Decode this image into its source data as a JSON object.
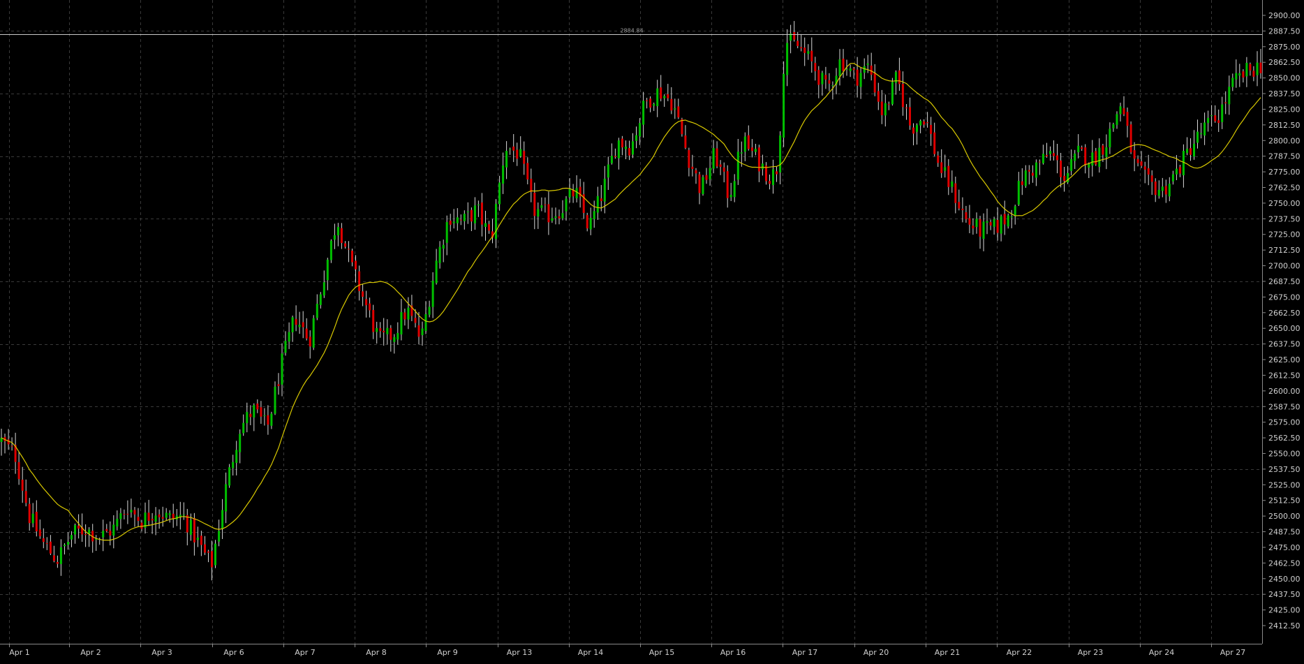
{
  "colors": {
    "background": "#000000",
    "grid": "#3a3a3a",
    "axis": "#8a8a8a",
    "text": "#d0d0d0",
    "bull": "#00c000",
    "bear": "#e00000",
    "ma": "#d8c800",
    "price_line": "#c8c8c8"
  },
  "chart_data": {
    "type": "candlestick",
    "title": "",
    "xlabel": "",
    "ylabel": "",
    "ylim": [
      2400,
      2900
    ],
    "grid": true,
    "price_line": {
      "value": 2884.84,
      "label": "2884.84"
    },
    "y_ticks": [
      2900.0,
      2887.5,
      2875.0,
      2862.5,
      2850.0,
      2837.5,
      2825.0,
      2812.5,
      2800.0,
      2787.5,
      2775.0,
      2762.5,
      2750.0,
      2737.5,
      2725.0,
      2712.5,
      2700.0,
      2687.5,
      2675.0,
      2662.5,
      2650.0,
      2637.5,
      2625.0,
      2612.5,
      2600.0,
      2587.5,
      2575.0,
      2562.5,
      2550.0,
      2537.5,
      2525.0,
      2512.5,
      2500.0,
      2487.5,
      2475.0,
      2462.5,
      2450.0,
      2437.5,
      2425.0,
      2412.5
    ],
    "y_tick_labels": [
      "2900.00",
      "2887.50",
      "2875.00",
      "2862.50",
      "2850.00",
      "2837.50",
      "2825.00",
      "2812.50",
      "2800.00",
      "2787.50",
      "2775.00",
      "2762.50",
      "2750.00",
      "2737.50",
      "2725.00",
      "2712.50",
      "2700.00",
      "2687.50",
      "2675.00",
      "2662.50",
      "2650.00",
      "2637.50",
      "2625.00",
      "2612.50",
      "2600.00",
      "2587.50",
      "2575.00",
      "2562.50",
      "2550.00",
      "2537.50",
      "2525.00",
      "2512.50",
      "2500.00",
      "2487.50",
      "2475.00",
      "2462.50",
      "2450.00",
      "2437.50",
      "2425.00",
      "2412.50"
    ],
    "x_labels": [
      "Apr 1",
      "Apr 2",
      "Apr 3",
      "Apr 6",
      "Apr 7",
      "Apr 8",
      "Apr 9",
      "Apr 13",
      "Apr 14",
      "Apr 15",
      "Apr 16",
      "Apr 17",
      "Apr 20",
      "Apr 21",
      "Apr 22",
      "Apr 23",
      "Apr 24",
      "Apr 27"
    ],
    "session_path": [
      [
        0,
        2560
      ],
      [
        2,
        2548
      ],
      [
        4,
        2500
      ],
      [
        6,
        2478
      ],
      [
        8,
        2465
      ],
      [
        10,
        2485
      ],
      [
        12,
        2490
      ],
      [
        14,
        2483
      ],
      [
        16,
        2490
      ],
      [
        18,
        2508
      ],
      [
        20,
        2496
      ],
      [
        22,
        2505
      ],
      [
        24,
        2498
      ],
      [
        26,
        2500
      ],
      [
        28,
        2480
      ],
      [
        30,
        2460
      ],
      [
        32,
        2520
      ],
      [
        34,
        2570
      ],
      [
        36,
        2585
      ],
      [
        38,
        2570
      ],
      [
        40,
        2620
      ],
      [
        42,
        2660
      ],
      [
        44,
        2640
      ],
      [
        46,
        2690
      ],
      [
        48,
        2738
      ],
      [
        50,
        2700
      ],
      [
        52,
        2670
      ],
      [
        54,
        2640
      ],
      [
        56,
        2645
      ],
      [
        58,
        2665
      ],
      [
        60,
        2640
      ],
      [
        62,
        2700
      ],
      [
        64,
        2740
      ],
      [
        66,
        2735
      ],
      [
        68,
        2745
      ],
      [
        70,
        2720
      ],
      [
        72,
        2795
      ],
      [
        74,
        2790
      ],
      [
        76,
        2745
      ],
      [
        78,
        2740
      ],
      [
        80,
        2745
      ],
      [
        82,
        2760
      ],
      [
        84,
        2730
      ],
      [
        86,
        2760
      ],
      [
        88,
        2800
      ],
      [
        90,
        2795
      ],
      [
        92,
        2830
      ],
      [
        94,
        2840
      ],
      [
        96,
        2830
      ],
      [
        98,
        2790
      ],
      [
        100,
        2760
      ],
      [
        102,
        2790
      ],
      [
        104,
        2755
      ],
      [
        106,
        2800
      ],
      [
        108,
        2785
      ],
      [
        110,
        2770
      ],
      [
        111,
        2780
      ],
      [
        112,
        2880
      ],
      [
        114,
        2875
      ],
      [
        116,
        2860
      ],
      [
        118,
        2840
      ],
      [
        120,
        2865
      ],
      [
        122,
        2850
      ],
      [
        124,
        2860
      ],
      [
        126,
        2820
      ],
      [
        128,
        2850
      ],
      [
        130,
        2810
      ],
      [
        132,
        2820
      ],
      [
        134,
        2780
      ],
      [
        136,
        2760
      ],
      [
        138,
        2735
      ],
      [
        140,
        2728
      ],
      [
        142,
        2730
      ],
      [
        144,
        2740
      ],
      [
        146,
        2770
      ],
      [
        148,
        2780
      ],
      [
        150,
        2790
      ],
      [
        152,
        2770
      ],
      [
        154,
        2790
      ],
      [
        156,
        2785
      ],
      [
        158,
        2800
      ],
      [
        160,
        2830
      ],
      [
        162,
        2780
      ],
      [
        164,
        2765
      ],
      [
        166,
        2760
      ],
      [
        168,
        2775
      ],
      [
        170,
        2795
      ],
      [
        172,
        2810
      ],
      [
        174,
        2820
      ],
      [
        176,
        2845
      ],
      [
        178,
        2855
      ],
      [
        180,
        2860
      ]
    ],
    "ma_period": 20
  }
}
